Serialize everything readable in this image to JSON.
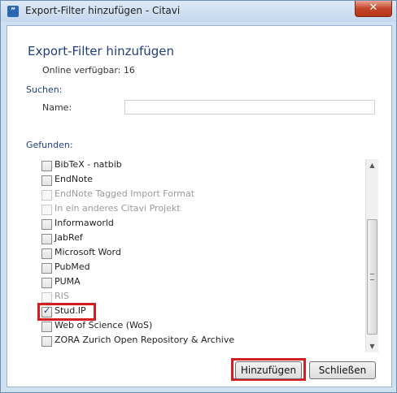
{
  "window": {
    "title": "Export-Filter hinzufügen - Citavi",
    "close_glyph": "✕"
  },
  "header": {
    "heading": "Export-Filter hinzufügen",
    "online_count": "Online verfügbar: 16"
  },
  "search": {
    "section_label": "Suchen:",
    "name_label": "Name:",
    "name_value": ""
  },
  "results": {
    "section_label": "Gefunden:",
    "items": [
      {
        "label": "BibTeX - natbib",
        "checked": false,
        "enabled": true
      },
      {
        "label": "EndNote",
        "checked": false,
        "enabled": true
      },
      {
        "label": "EndNote Tagged Import Format",
        "checked": false,
        "enabled": false
      },
      {
        "label": "In ein anderes Citavi Projekt",
        "checked": false,
        "enabled": false
      },
      {
        "label": "Informaworld",
        "checked": false,
        "enabled": true
      },
      {
        "label": "JabRef",
        "checked": false,
        "enabled": true
      },
      {
        "label": "Microsoft Word",
        "checked": false,
        "enabled": true
      },
      {
        "label": "PubMed",
        "checked": false,
        "enabled": true
      },
      {
        "label": "PUMA",
        "checked": false,
        "enabled": true
      },
      {
        "label": "RIS",
        "checked": false,
        "enabled": false
      },
      {
        "label": "Stud.IP",
        "checked": true,
        "enabled": true
      },
      {
        "label": "Web of Science (WoS)",
        "checked": false,
        "enabled": true
      },
      {
        "label": "ZORA Zurich Open Repository & Archive",
        "checked": false,
        "enabled": true
      }
    ]
  },
  "buttons": {
    "add": "Hinzufügen",
    "close": "Schließen"
  },
  "colors": {
    "highlight": "#d11f24",
    "heading": "#1f3f7a"
  }
}
